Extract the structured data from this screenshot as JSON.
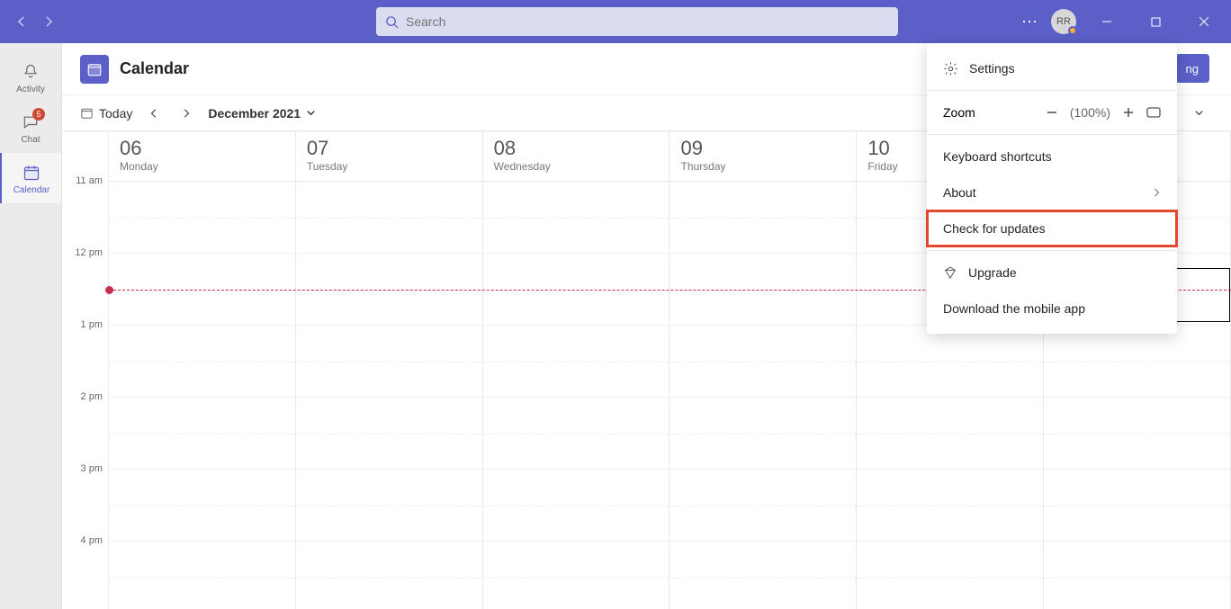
{
  "titlebar": {
    "search_placeholder": "Search",
    "avatar_initials": "RR"
  },
  "rail": {
    "items": [
      {
        "label": "Activity",
        "icon": "bell"
      },
      {
        "label": "Chat",
        "icon": "chat",
        "badge": "5"
      },
      {
        "label": "Calendar",
        "icon": "calendar",
        "active": true
      }
    ]
  },
  "header": {
    "title": "Calendar",
    "new_meeting_suffix": "ng"
  },
  "toolbar": {
    "today_label": "Today",
    "month_label": "December 2021"
  },
  "days": [
    {
      "num": "06",
      "name": "Monday"
    },
    {
      "num": "07",
      "name": "Tuesday"
    },
    {
      "num": "08",
      "name": "Wednesday"
    },
    {
      "num": "09",
      "name": "Thursday"
    },
    {
      "num": "10",
      "name": "Friday"
    },
    {
      "num": "",
      "name": ""
    }
  ],
  "times": [
    "11 am",
    "12 pm",
    "1 pm",
    "2 pm",
    "3 pm",
    "4 pm"
  ],
  "dropdown": {
    "settings": "Settings",
    "zoom_label": "Zoom",
    "zoom_pct": "(100%)",
    "keyboard": "Keyboard shortcuts",
    "about": "About",
    "check_updates": "Check for updates",
    "upgrade": "Upgrade",
    "download_mobile": "Download the mobile app"
  }
}
